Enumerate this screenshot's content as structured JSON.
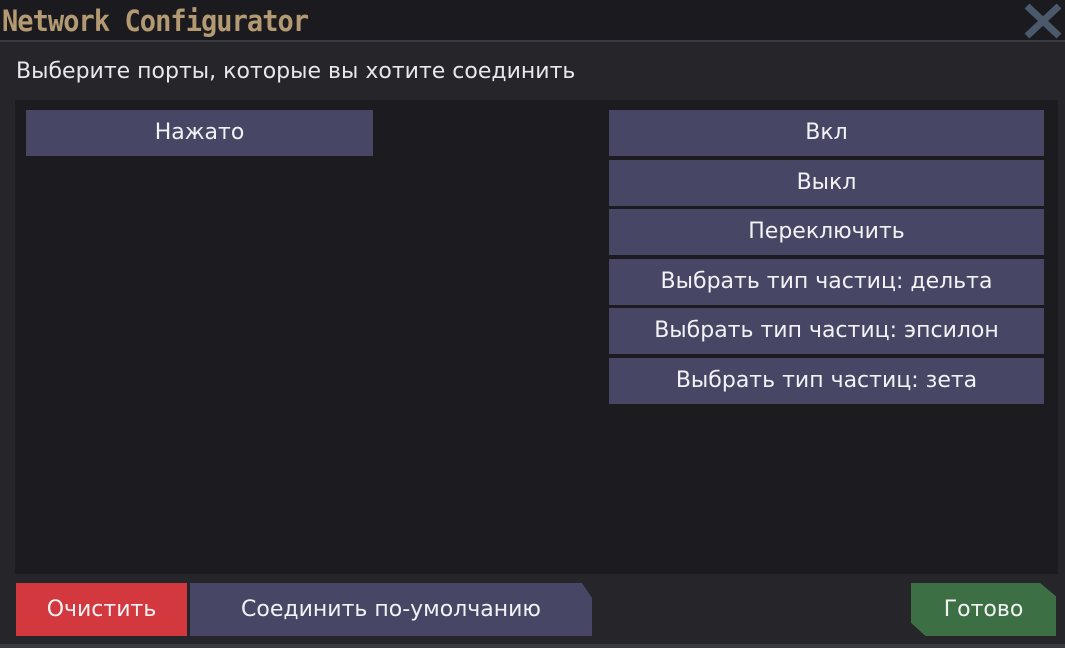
{
  "window": {
    "title": "Network Configurator",
    "close_icon": "close-icon"
  },
  "main": {
    "instruction": "Выберите порты, которые вы хотите соединить",
    "source_ports": [
      "Нажато"
    ],
    "sink_ports": [
      "Вкл",
      "Выкл",
      "Переключить",
      "Выбрать тип частиц: дельта",
      "Выбрать тип частиц: эпсилон",
      "Выбрать тип частиц: зета"
    ]
  },
  "footer": {
    "clear_label": "Очистить",
    "connect_default_label": "Соединить по-умолчанию",
    "done_label": "Готово"
  },
  "colors": {
    "background": "#25252a",
    "panel": "#1c1c20",
    "button": "#474765",
    "clear": "#d2383d",
    "done": "#3c6f43",
    "title": "#b39a72"
  }
}
